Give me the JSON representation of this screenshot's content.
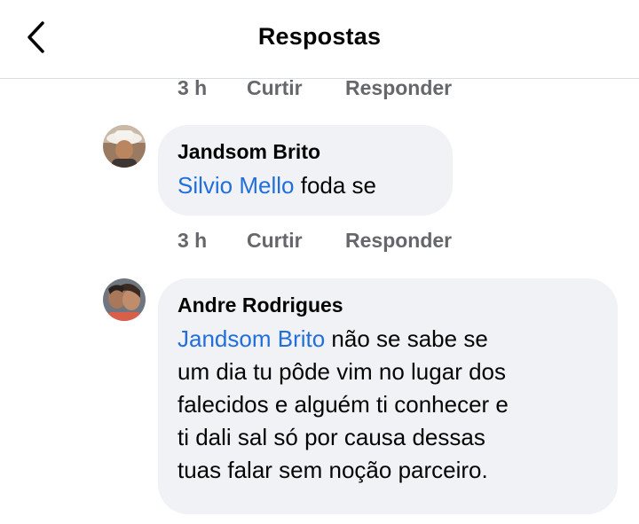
{
  "header": {
    "title": "Respostas"
  },
  "top_meta": {
    "time": "3 h",
    "like_label": "Curtir",
    "reply_label": "Responder"
  },
  "comments": [
    {
      "author": "Jandsom Brito",
      "mention": "Silvio Mello",
      "text": "foda se",
      "time": "3 h",
      "like_label": "Curtir",
      "reply_label": "Responder"
    },
    {
      "author": "Andre Rodrigues",
      "mention": "Jandsom Brito",
      "text_line1": "não se sabe se",
      "text_line2": "um dia tu pôde vim no lugar dos",
      "text_line3": "falecidos e alguém ti conhecer e",
      "text_line4": "ti dali sal só por causa dessas",
      "text_line5": "tuas falar sem noção parceiro."
    }
  ],
  "colors": {
    "mention": "#216fdb",
    "bubble": "#f0f2f5",
    "meta": "#65676b"
  },
  "icons": {
    "back": "chevron-left-icon",
    "avatar": "user-avatar"
  }
}
